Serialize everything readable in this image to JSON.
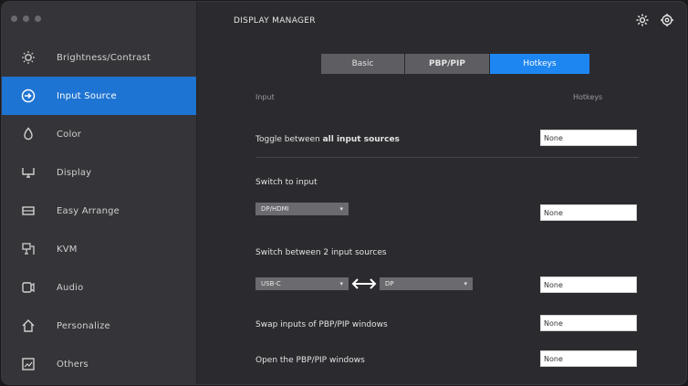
{
  "window": {
    "title": "DISPLAY MANAGER"
  },
  "sidebar": {
    "items": [
      {
        "label": "Brightness/Contrast",
        "icon": "brightness-icon",
        "active": false
      },
      {
        "label": "Input Source",
        "icon": "input-source-icon",
        "active": true
      },
      {
        "label": "Color",
        "icon": "color-icon",
        "active": false
      },
      {
        "label": "Display",
        "icon": "display-icon",
        "active": false
      },
      {
        "label": "Easy Arrange",
        "icon": "easy-arrange-icon",
        "active": false
      },
      {
        "label": "KVM",
        "icon": "kvm-icon",
        "active": false
      },
      {
        "label": "Audio",
        "icon": "audio-icon",
        "active": false
      },
      {
        "label": "Personalize",
        "icon": "personalize-icon",
        "active": false
      },
      {
        "label": "Others",
        "icon": "others-icon",
        "active": false
      }
    ]
  },
  "tabs": [
    {
      "label": "Basic",
      "active": false
    },
    {
      "label": "PBP/PIP",
      "active": false
    },
    {
      "label": "Hotkeys",
      "active": true
    }
  ],
  "hotkeys": {
    "col_input": "Input",
    "col_hotkey": "Hotkeys",
    "rows": [
      {
        "label_pre": "Toggle between ",
        "label_bold": "all input sources",
        "value": "None"
      },
      {
        "label": "Switch to input",
        "dropdown": "DP/HDMI",
        "value": "None"
      },
      {
        "label": "Switch between 2 input sources",
        "dropdown_a": "USB-C",
        "dropdown_b": "DP",
        "value": "None"
      },
      {
        "label": "Swap inputs of PBP/PIP windows",
        "value": "None"
      },
      {
        "label": "Open the PBP/PIP windows",
        "value": "None"
      }
    ]
  },
  "colors": {
    "accent": "#1e74d2",
    "tab_active": "#1e86f0"
  }
}
